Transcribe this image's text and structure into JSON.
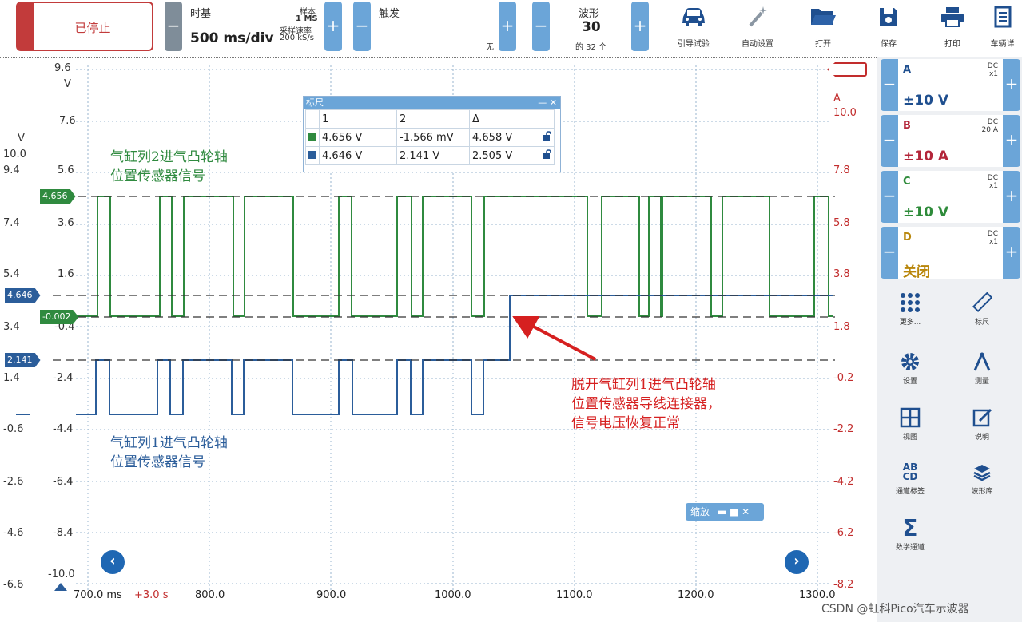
{
  "toolbar": {
    "status_label": "已停止",
    "timebase_title": "时基",
    "timebase_value": "500 ms/div",
    "samples_label": "样本",
    "samples_value": "1 MS",
    "rate_label": "采样速率",
    "rate_value": "200 kS/s",
    "trigger_title": "触发",
    "trigger_value": "无",
    "waveform_title": "波形",
    "waveform_value": "30",
    "waveform_of": "的 32 个",
    "guided_test": "引导试验",
    "auto_setup": "自动设置",
    "open": "打开",
    "save": "保存",
    "print": "打印",
    "vehicle": "车辆详"
  },
  "axes": {
    "left_outer": [
      "9.6",
      "V",
      "7.6",
      "10.0",
      "9.4",
      "7.4",
      "5.4",
      "4.646",
      "3.4",
      "2.141",
      "1.4",
      "-0.6",
      "-2.6",
      "-4.6",
      "-6.6"
    ],
    "left_outer_v": "V",
    "left_inner": [
      "5.6",
      "3.6",
      "1.6",
      "-0.4",
      "-2.4",
      "-4.4",
      "-6.4",
      "-8.4",
      "-10.0"
    ],
    "right": [
      "A",
      "10.0",
      "7.8",
      "5.8",
      "3.8",
      "1.8",
      "-0.2",
      "-2.2",
      "-4.2",
      "-6.2",
      "-8.2"
    ],
    "x": [
      "700.0 ms",
      "+3.0 s",
      "800.0",
      "900.0",
      "1000.0",
      "1100.0",
      "1200.0",
      "1300.0"
    ]
  },
  "tags": {
    "green_high": "4.656",
    "green_low": "-0.002",
    "blue_high": "4.646",
    "blue_low": "2.141"
  },
  "ruler": {
    "title": "标尺",
    "headers": [
      "1",
      "2",
      "Δ"
    ],
    "rows": [
      {
        "v1": "4.656 V",
        "v2": "-1.566 mV",
        "d": "4.658 V"
      },
      {
        "v1": "4.646 V",
        "v2": "2.141 V",
        "d": "2.505 V"
      }
    ]
  },
  "annotations": {
    "green_line1": "气缸列2进气凸轮轴",
    "green_line2": "位置传感器信号",
    "blue_line1": "气缸列1进气凸轮轴",
    "blue_line2": "位置传感器信号",
    "red_line1": "脱开气缸列1进气凸轮轴",
    "red_line2": "位置传感器导线连接器，",
    "red_line3": "信号电压恢复正常"
  },
  "zoom_label": "缩放",
  "channels": [
    {
      "name": "A",
      "coupling": "DC",
      "probe": "x1",
      "range": "±10 V",
      "color": "#1f4f8f"
    },
    {
      "name": "B",
      "coupling": "DC",
      "probe": "20 A",
      "range": "±10 A",
      "color": "#b3263a"
    },
    {
      "name": "C",
      "coupling": "DC",
      "probe": "x1",
      "range": "±10 V",
      "color": "#2e8b3a"
    },
    {
      "name": "D",
      "coupling": "DC",
      "probe": "x1",
      "range": "关闭",
      "color": "#b8860b"
    }
  ],
  "tools": {
    "more": "更多...",
    "ruler": "标尺",
    "settings": "设置",
    "measure": "测量",
    "view": "视图",
    "notes": "说明",
    "channel_labels": "通道标签",
    "ab_icon": "AB",
    "cd_icon": "CD",
    "library": "波形库",
    "math": "数学通道"
  },
  "watermark": "CSDN @虹科Pico汽车示波器",
  "colors": {
    "green": "#2f8a3f",
    "blue": "#2b5d9a",
    "red": "#d62020",
    "accent": "#6ba5d8"
  }
}
